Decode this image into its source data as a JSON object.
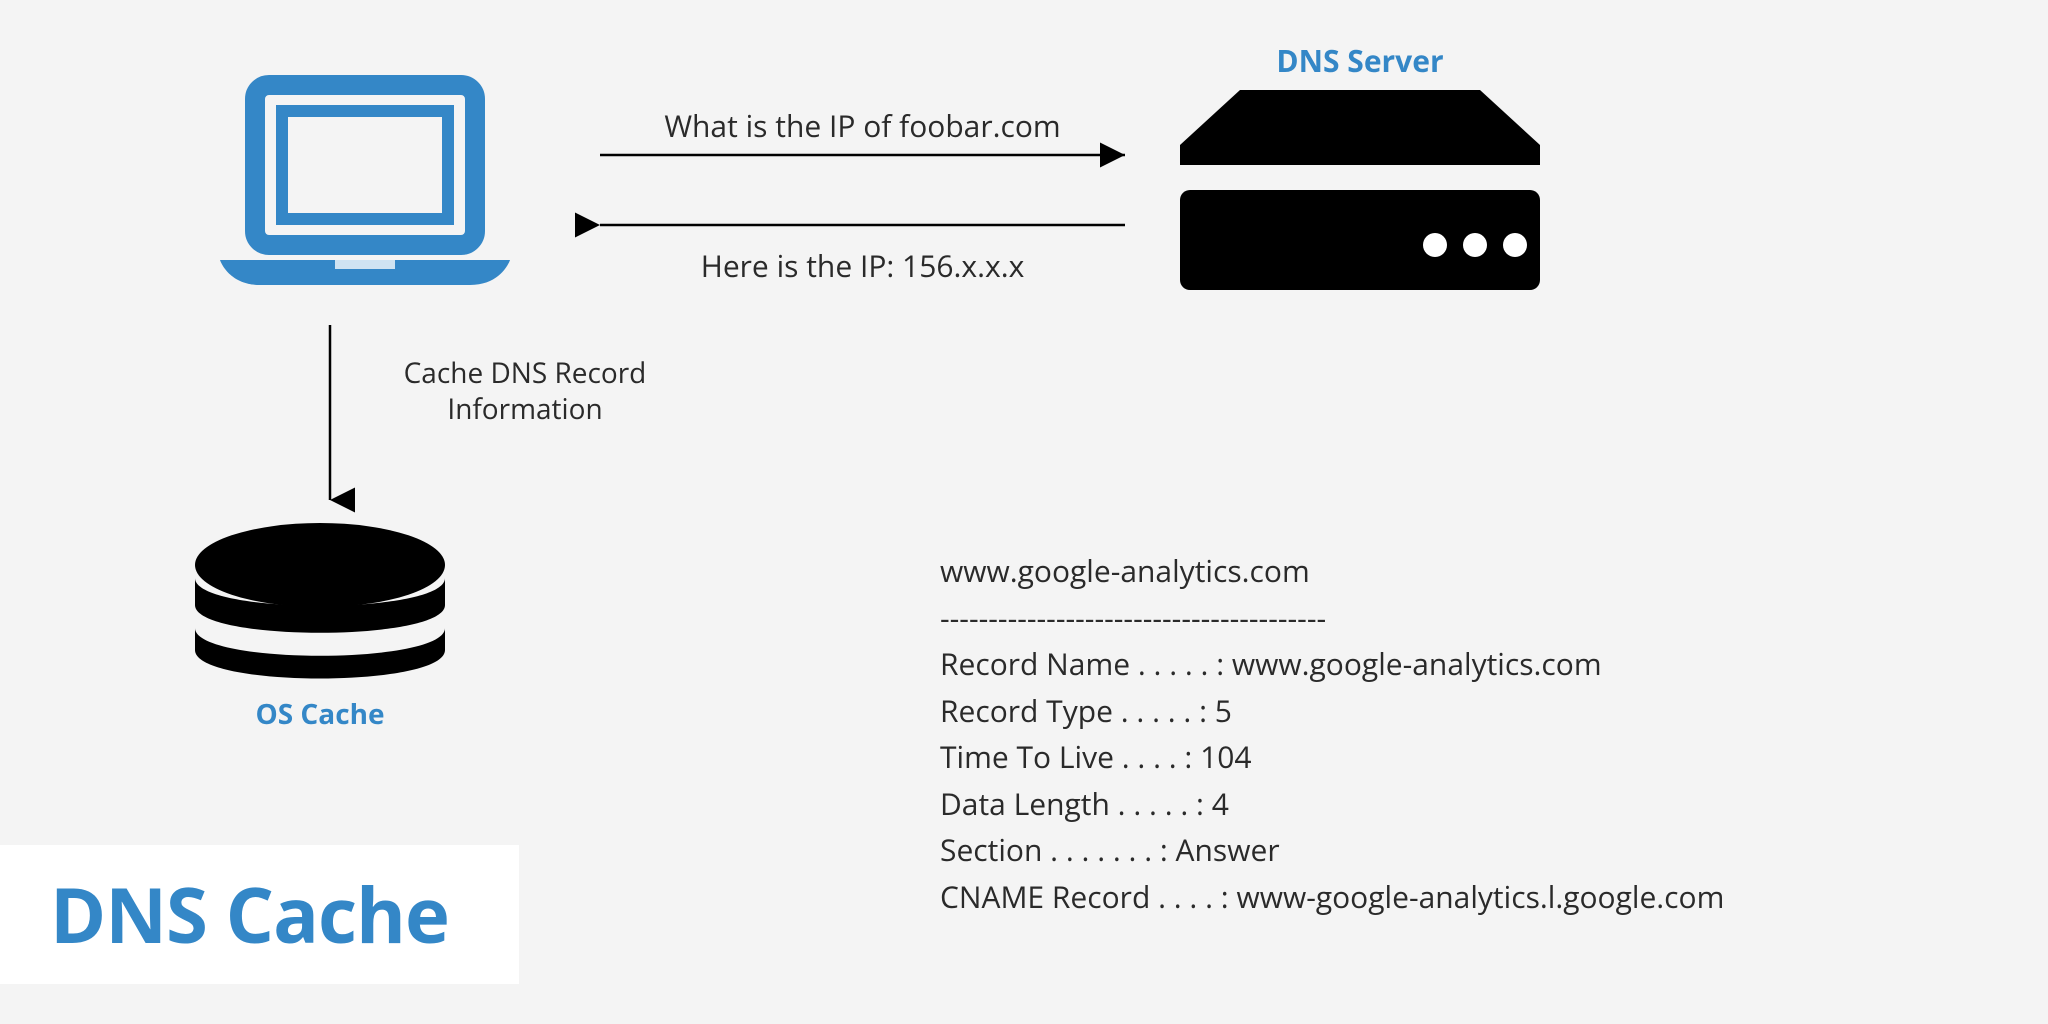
{
  "labels": {
    "dns_server": "DNS Server",
    "os_cache": "OS Cache"
  },
  "messages": {
    "query": "What is the IP of foobar.com",
    "reply": "Here is the IP: 156.x.x.x",
    "cache_line1": "Cache DNS Record",
    "cache_line2": "Information"
  },
  "title": "DNS Cache",
  "record": {
    "heading": "www.google-analytics.com",
    "divider": "----------------------------------------",
    "lines": [
      "Record Name . . . . . : www.google-analytics.com",
      "Record Type . . . . . : 5",
      "Time To Live  . . . . : 104",
      "Data Length . . . . . : 4",
      "Section . . . . . . . : Answer",
      "CNAME Record  . . . . : www-google-analytics.l.google.com"
    ]
  }
}
